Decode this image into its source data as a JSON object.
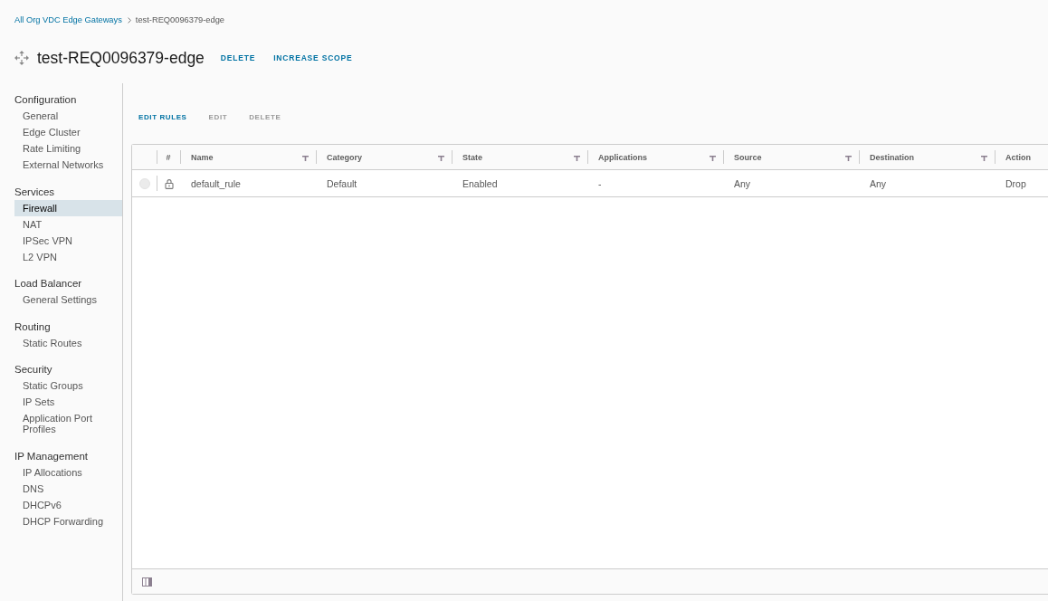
{
  "breadcrumb": [
    {
      "label": "All Org VDC Edge Gateways",
      "kind": "link"
    },
    {
      "label": "test-REQ0096379-edge",
      "kind": "current"
    }
  ],
  "header": {
    "title": "test-REQ0096379-edge",
    "actions": [
      {
        "label": "DELETE"
      },
      {
        "label": "INCREASE SCOPE"
      }
    ]
  },
  "sidebar": {
    "groups": [
      {
        "title": "Configuration",
        "items": [
          {
            "label": "General",
            "selected": false
          },
          {
            "label": "Edge Cluster",
            "selected": false
          },
          {
            "label": "Rate Limiting",
            "selected": false
          },
          {
            "label": "External Networks",
            "selected": false
          }
        ]
      },
      {
        "title": "Services",
        "items": [
          {
            "label": "Firewall",
            "selected": true
          },
          {
            "label": "NAT",
            "selected": false
          },
          {
            "label": "IPSec VPN",
            "selected": false
          },
          {
            "label": "L2 VPN",
            "selected": false
          }
        ]
      },
      {
        "title": "Load Balancer",
        "items": [
          {
            "label": "General Settings",
            "selected": false
          }
        ]
      },
      {
        "title": "Routing",
        "items": [
          {
            "label": "Static Routes",
            "selected": false
          }
        ]
      },
      {
        "title": "Security",
        "items": [
          {
            "label": "Static Groups",
            "selected": false
          },
          {
            "label": "IP Sets",
            "selected": false
          },
          {
            "label": "Application Port Profiles",
            "selected": false
          }
        ]
      },
      {
        "title": "IP Management",
        "items": [
          {
            "label": "IP Allocations",
            "selected": false
          },
          {
            "label": "DNS",
            "selected": false
          },
          {
            "label": "DHCPv6",
            "selected": false
          },
          {
            "label": "DHCP Forwarding",
            "selected": false
          }
        ]
      }
    ]
  },
  "toolbar": {
    "buttons": [
      {
        "label": "EDIT RULES",
        "disabled": false
      },
      {
        "label": "EDIT",
        "disabled": true
      },
      {
        "label": "DELETE",
        "disabled": true
      }
    ]
  },
  "table": {
    "columns": [
      {
        "label": "#",
        "filter": false
      },
      {
        "label": "Name",
        "filter": true
      },
      {
        "label": "Category",
        "filter": true
      },
      {
        "label": "State",
        "filter": true
      },
      {
        "label": "Applications",
        "filter": true
      },
      {
        "label": "Source",
        "filter": true
      },
      {
        "label": "Destination",
        "filter": true
      },
      {
        "label": "Action",
        "filter": false
      }
    ],
    "rows": [
      {
        "selected": false,
        "locked": true,
        "cells": [
          "",
          "default_rule",
          "Default",
          "Enabled",
          "-",
          "Any",
          "Any",
          "Drop"
        ]
      }
    ]
  }
}
